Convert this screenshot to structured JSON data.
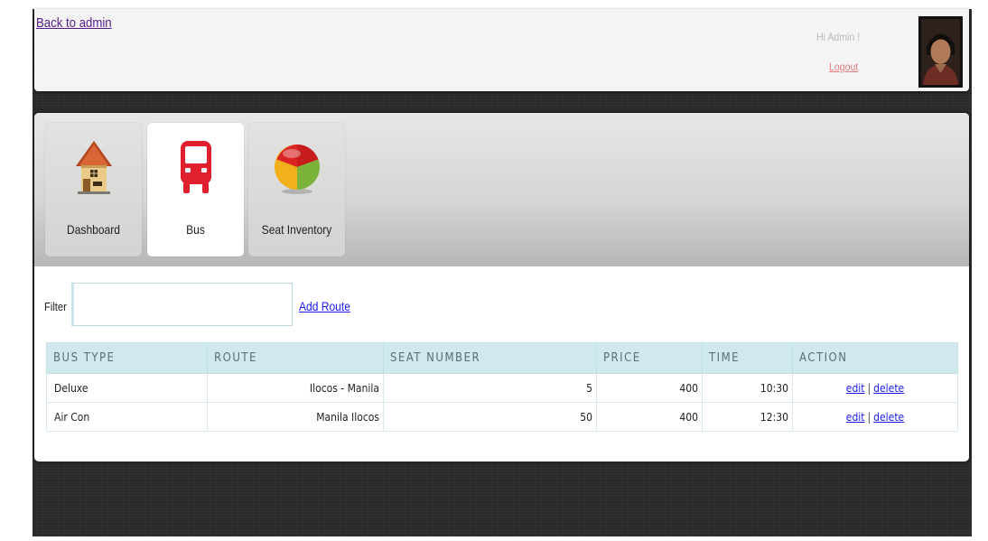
{
  "header": {
    "back_link": "Back to admin",
    "greeting": "Hi Admin !",
    "logout": "Logout"
  },
  "nav": {
    "tabs": [
      {
        "label": "Dashboard",
        "icon": "house-icon",
        "active": false
      },
      {
        "label": "Bus",
        "icon": "bus-icon",
        "active": true
      },
      {
        "label": "Seat Inventory",
        "icon": "pie-chart-icon",
        "active": false
      }
    ]
  },
  "filter": {
    "label": "Filter",
    "value": "",
    "add_route": "Add Route"
  },
  "table": {
    "headers": [
      "BUS TYPE",
      "ROUTE",
      "SEAT NUMBER",
      "PRICE",
      "TIME",
      "ACTION"
    ],
    "rows": [
      {
        "bus_type": "Deluxe",
        "route": "Ilocos - Manila",
        "seat_number": "5",
        "price": "400",
        "time": "10:30",
        "edit": "edit",
        "sep": "|",
        "delete": "delete"
      },
      {
        "bus_type": "Air Con",
        "route": "Manila Ilocos",
        "seat_number": "50",
        "price": "400",
        "time": "12:30",
        "edit": "edit",
        "sep": "|",
        "delete": "delete"
      }
    ]
  },
  "colors": {
    "link": "#1a1aee",
    "visited_link": "#551a8b",
    "logout": "#e67b7b",
    "bus_icon": "#e0202e",
    "table_header_bg": "#cfe9ed"
  }
}
